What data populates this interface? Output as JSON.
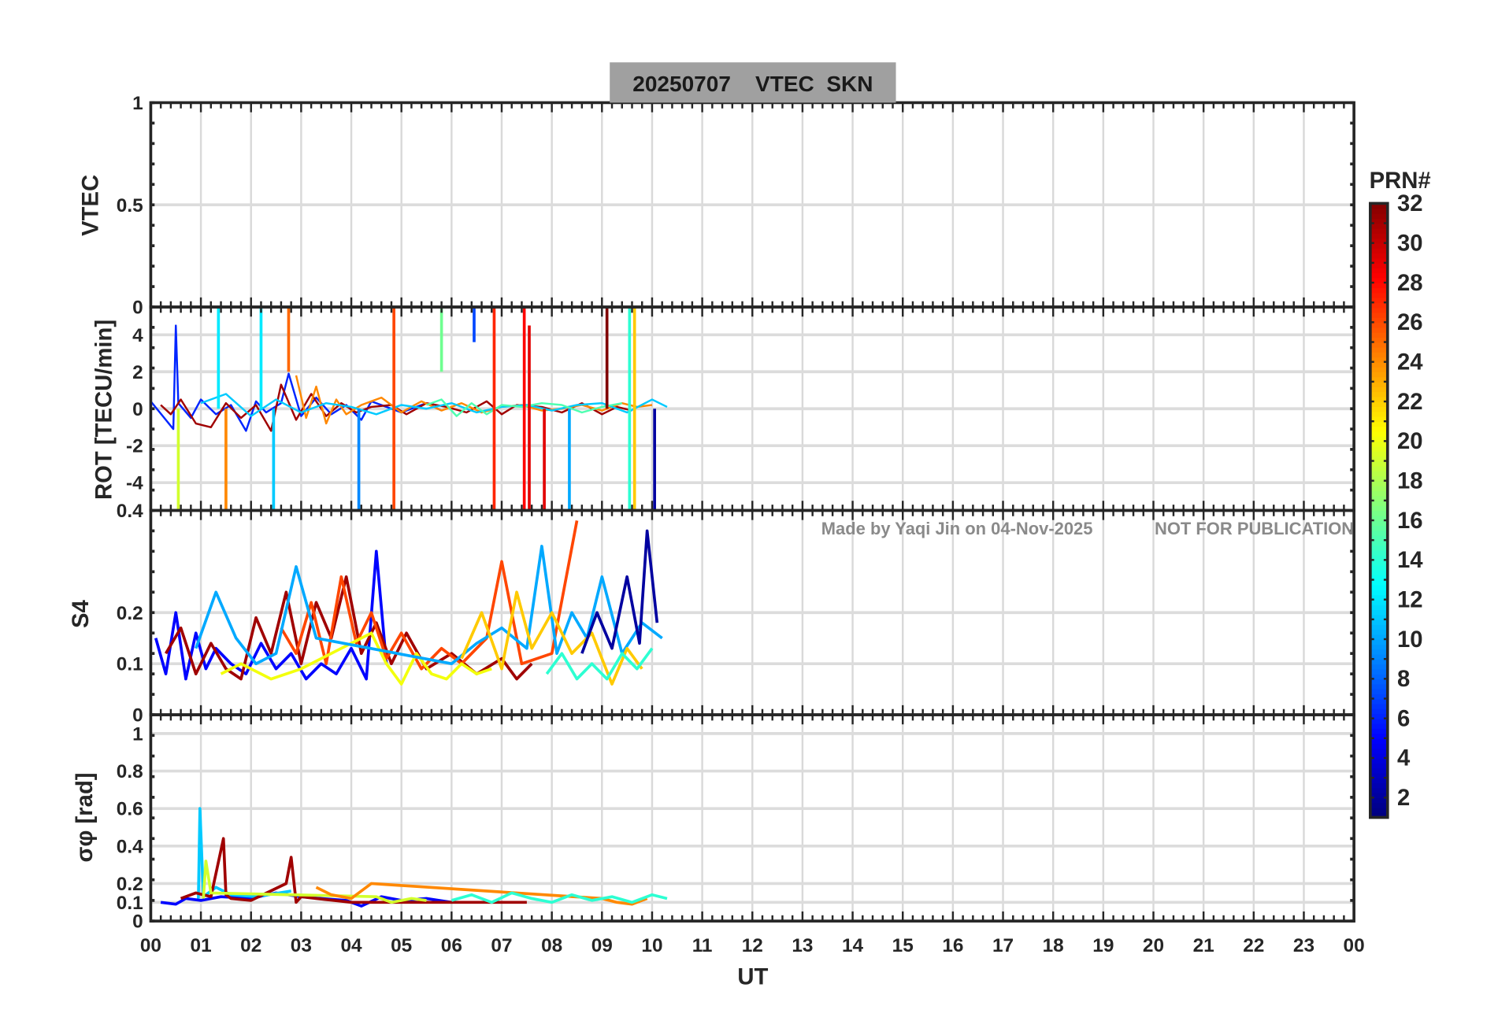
{
  "title": "20250707    VTEC  SKN",
  "watermark": {
    "left": "Made by Yaqi Jin on 04-Nov-2025",
    "right": "NOT FOR PUBLICATION"
  },
  "colorbar": {
    "label": "PRN#",
    "range": [
      1,
      32
    ],
    "ticks": [
      "2",
      "4",
      "6",
      "8",
      "10",
      "12",
      "14",
      "16",
      "18",
      "20",
      "22",
      "24",
      "26",
      "28",
      "30",
      "32"
    ],
    "colormap": "jet"
  },
  "x_axis": {
    "label": "UT",
    "range_hours": [
      0,
      24
    ],
    "ticks": [
      "00",
      "01",
      "02",
      "03",
      "04",
      "05",
      "06",
      "07",
      "08",
      "09",
      "10",
      "11",
      "12",
      "13",
      "14",
      "15",
      "16",
      "17",
      "18",
      "19",
      "20",
      "21",
      "22",
      "23",
      "00"
    ]
  },
  "chart_data": [
    {
      "type": "line",
      "panel": "vtec",
      "ylabel": "VTEC",
      "ylim": [
        0,
        1
      ],
      "yticks": [
        "0",
        "0.5",
        "1"
      ],
      "grid": true,
      "series": []
    },
    {
      "type": "line",
      "panel": "rot",
      "ylabel": "ROT [TECU/min]",
      "ylim": [
        -5.5,
        5.5
      ],
      "yticks": [
        "-4",
        "-2",
        "0",
        "2",
        "4"
      ],
      "grid": true,
      "series": [
        {
          "prn": 6,
          "x": [
            0.0,
            0.3,
            0.45,
            0.5,
            0.55,
            0.8,
            1.0,
            1.3,
            1.6,
            1.9,
            2.1,
            2.3,
            2.6,
            2.75,
            3.0,
            3.3,
            3.6,
            3.9,
            4.2,
            4.4,
            4.7,
            5.0,
            5.5,
            5.8
          ],
          "y": [
            0.4,
            -0.6,
            -1.1,
            4.5,
            0.3,
            -0.5,
            0.5,
            -0.3,
            0.2,
            -1.2,
            0.4,
            -0.2,
            0.3,
            1.9,
            -0.4,
            0.6,
            -0.3,
            0.2,
            -0.6,
            0.4,
            0.1,
            -0.2,
            0.3,
            -0.1
          ]
        },
        {
          "prn": 31,
          "x": [
            0.2,
            0.4,
            0.6,
            0.9,
            1.2,
            1.5,
            1.8,
            2.1,
            2.4,
            2.6,
            2.9,
            3.2,
            3.5,
            3.8,
            4.1,
            4.4,
            4.8,
            5.1,
            5.5,
            5.9,
            6.3,
            6.7,
            7.0,
            7.3,
            7.8,
            8.2,
            8.6,
            9.0,
            9.3,
            9.6
          ],
          "y": [
            0.2,
            -0.3,
            0.5,
            -0.8,
            -1.0,
            0.3,
            -0.5,
            0.2,
            -1.2,
            1.3,
            -0.6,
            0.8,
            -0.4,
            0.3,
            -0.2,
            0.1,
            0.2,
            -0.3,
            0.3,
            0.1,
            -0.2,
            0.4,
            -0.3,
            0.2,
            0.1,
            -0.2,
            0.3,
            -0.3,
            0.1,
            -0.1
          ]
        },
        {
          "prn": 24,
          "x": [
            2.9,
            3.1,
            3.3,
            3.5,
            3.7,
            3.9,
            4.2,
            4.6,
            5.0,
            5.4,
            5.8,
            6.2,
            6.6,
            7.0,
            7.4,
            7.8,
            8.2,
            8.6,
            9.0,
            9.4,
            9.7,
            10.0
          ],
          "y": [
            1.8,
            -0.5,
            1.2,
            -0.8,
            0.5,
            -0.3,
            0.2,
            0.6,
            -0.2,
            0.4,
            -0.1,
            0.3,
            -0.2,
            0.1,
            0.2,
            -0.1,
            0.0,
            0.2,
            -0.1,
            0.3,
            0.1,
            0.2
          ]
        },
        {
          "prn": 11,
          "x": [
            1.0,
            1.5,
            2.0,
            2.5,
            3.0,
            3.5,
            4.0,
            4.5,
            5.0,
            5.5,
            6.0,
            6.5,
            7.0,
            7.5,
            8.0,
            8.5,
            9.0,
            9.5,
            10.0,
            10.3
          ],
          "y": [
            0.3,
            0.8,
            -0.4,
            0.5,
            -0.2,
            0.3,
            0.1,
            -0.3,
            0.2,
            0.0,
            0.3,
            -0.2,
            0.1,
            0.2,
            -0.1,
            0.2,
            0.3,
            -0.2,
            0.5,
            0.1
          ]
        },
        {
          "prn": 15,
          "x": [
            5.5,
            5.8,
            6.1,
            6.4,
            6.7,
            7.0,
            7.4,
            7.8,
            8.2,
            8.6,
            9.0,
            9.4
          ],
          "y": [
            0.2,
            0.5,
            -0.4,
            0.3,
            -0.3,
            0.2,
            0.1,
            0.3,
            0.2,
            -0.2,
            0.1,
            0.3
          ]
        }
      ],
      "spikes": [
        {
          "prn": 19,
          "x": 0.55,
          "from": 0,
          "to": -5.5
        },
        {
          "prn": 12,
          "x": 1.35,
          "from": 0,
          "to": 5.5
        },
        {
          "prn": 24,
          "x": 1.5,
          "from": 0,
          "to": -5.5
        },
        {
          "prn": 12,
          "x": 2.2,
          "from": 0,
          "to": 5.5
        },
        {
          "prn": 11,
          "x": 2.45,
          "from": 0,
          "to": -5.5
        },
        {
          "prn": 25,
          "x": 2.75,
          "from": 2,
          "to": 5.5
        },
        {
          "prn": 9,
          "x": 4.15,
          "from": 0,
          "to": -5.5
        },
        {
          "prn": 26,
          "x": 4.85,
          "from": 5.5,
          "to": -5.5
        },
        {
          "prn": 16,
          "x": 5.8,
          "from": 2,
          "to": 5.5
        },
        {
          "prn": 7,
          "x": 6.45,
          "from": 3.6,
          "to": 5.5
        },
        {
          "prn": 27,
          "x": 6.85,
          "from": 5.5,
          "to": -5.5
        },
        {
          "prn": 28,
          "x": 7.45,
          "from": 5.5,
          "to": -5.5
        },
        {
          "prn": 29,
          "x": 7.55,
          "from": 4.5,
          "to": -5.5
        },
        {
          "prn": 29,
          "x": 7.85,
          "from": 0,
          "to": -5.5
        },
        {
          "prn": 10,
          "x": 8.35,
          "from": 0,
          "to": -5.5
        },
        {
          "prn": 32,
          "x": 9.1,
          "from": 5.5,
          "to": 0
        },
        {
          "prn": 14,
          "x": 9.55,
          "from": 5.5,
          "to": -5.5
        },
        {
          "prn": 22,
          "x": 9.65,
          "from": 5.5,
          "to": -5.5
        },
        {
          "prn": 2,
          "x": 10.05,
          "from": 0,
          "to": -5.5
        }
      ]
    },
    {
      "type": "line",
      "panel": "s4",
      "ylabel": "S4",
      "ylim": [
        0,
        0.4
      ],
      "yticks": [
        "0",
        "0.1",
        "0.2",
        "0.4"
      ],
      "grid": true,
      "series": [
        {
          "prn": 5,
          "x": [
            0.1,
            0.3,
            0.5,
            0.7,
            0.9,
            1.1,
            1.3,
            1.6,
            1.9,
            2.2,
            2.5,
            2.8,
            3.1,
            3.4,
            3.7,
            4.0,
            4.3,
            4.5,
            4.7
          ],
          "y": [
            0.15,
            0.08,
            0.2,
            0.07,
            0.16,
            0.09,
            0.13,
            0.1,
            0.08,
            0.14,
            0.09,
            0.12,
            0.07,
            0.1,
            0.08,
            0.13,
            0.07,
            0.32,
            0.1
          ]
        },
        {
          "prn": 31,
          "x": [
            0.3,
            0.6,
            0.9,
            1.2,
            1.5,
            1.8,
            2.1,
            2.4,
            2.7,
            3.0,
            3.3,
            3.6,
            3.9,
            4.2,
            4.5,
            4.8,
            5.1,
            5.5,
            6.0,
            6.5,
            7.0,
            7.3,
            7.6
          ],
          "y": [
            0.12,
            0.17,
            0.08,
            0.14,
            0.09,
            0.07,
            0.19,
            0.12,
            0.24,
            0.1,
            0.22,
            0.15,
            0.27,
            0.12,
            0.18,
            0.1,
            0.16,
            0.09,
            0.12,
            0.08,
            0.11,
            0.07,
            0.1
          ]
        },
        {
          "prn": 26,
          "x": [
            2.6,
            2.9,
            3.2,
            3.5,
            3.8,
            4.1,
            4.4,
            4.7,
            5.0,
            5.4,
            5.8,
            6.2,
            6.7,
            7.0,
            7.4,
            8.0,
            8.5
          ],
          "y": [
            0.17,
            0.12,
            0.22,
            0.1,
            0.27,
            0.14,
            0.2,
            0.11,
            0.16,
            0.09,
            0.13,
            0.1,
            0.15,
            0.3,
            0.1,
            0.12,
            0.38
          ]
        },
        {
          "prn": 20,
          "x": [
            1.4,
            1.8,
            2.4,
            3.0,
            4.4,
            4.7,
            5.0,
            5.3,
            5.6,
            5.9,
            6.2,
            6.5,
            6.8
          ],
          "y": [
            0.08,
            0.1,
            0.07,
            0.09,
            0.16,
            0.1,
            0.06,
            0.12,
            0.08,
            0.07,
            0.1,
            0.08,
            0.09
          ]
        },
        {
          "prn": 10,
          "x": [
            0.9,
            1.3,
            1.7,
            2.1,
            2.5,
            2.9,
            3.3,
            6.0,
            6.5,
            7.0,
            7.5,
            7.8,
            8.1,
            8.4,
            8.7,
            9.0,
            9.4,
            9.8,
            10.2
          ],
          "y": [
            0.13,
            0.24,
            0.15,
            0.1,
            0.12,
            0.29,
            0.15,
            0.1,
            0.14,
            0.17,
            0.13,
            0.33,
            0.12,
            0.2,
            0.15,
            0.27,
            0.12,
            0.18,
            0.15
          ]
        },
        {
          "prn": 22,
          "x": [
            6.2,
            6.6,
            7.0,
            7.3,
            7.6,
            8.0,
            8.4,
            8.8,
            9.2,
            9.5,
            9.8
          ],
          "y": [
            0.11,
            0.2,
            0.09,
            0.24,
            0.13,
            0.2,
            0.12,
            0.16,
            0.06,
            0.13,
            0.09
          ]
        },
        {
          "prn": 14,
          "x": [
            7.9,
            8.2,
            8.5,
            8.8,
            9.1,
            9.4,
            9.7,
            10.0
          ],
          "y": [
            0.08,
            0.12,
            0.07,
            0.1,
            0.07,
            0.12,
            0.09,
            0.13
          ]
        },
        {
          "prn": 2,
          "x": [
            8.6,
            8.9,
            9.2,
            9.5,
            9.75,
            9.9,
            10.1
          ],
          "y": [
            0.12,
            0.2,
            0.13,
            0.27,
            0.14,
            0.36,
            0.18
          ]
        }
      ]
    },
    {
      "type": "line",
      "panel": "sigma_phi",
      "ylabel": "σφ [rad]",
      "ylim": [
        0,
        1.1
      ],
      "yticks": [
        "0",
        "0.1",
        "0.2",
        "0.4",
        "0.6",
        "0.8",
        "1"
      ],
      "grid": true,
      "series": [
        {
          "prn": 5,
          "x": [
            0.2,
            0.5,
            0.7,
            1.0,
            1.4,
            2.0,
            2.5,
            3.0,
            3.4,
            3.9,
            4.2,
            4.6,
            5.0,
            5.5,
            6.0
          ],
          "y": [
            0.1,
            0.09,
            0.12,
            0.11,
            0.13,
            0.12,
            0.15,
            0.13,
            0.12,
            0.11,
            0.08,
            0.13,
            0.11,
            0.12,
            0.1
          ]
        },
        {
          "prn": 11,
          "x": [
            0.95,
            0.98,
            1.05,
            1.3,
            1.6,
            2.1,
            2.8
          ],
          "y": [
            0.12,
            0.6,
            0.13,
            0.18,
            0.14,
            0.13,
            0.16
          ]
        },
        {
          "prn": 31,
          "x": [
            0.6,
            0.9,
            1.2,
            1.45,
            1.5,
            1.6,
            2.0,
            2.7,
            2.8,
            2.9,
            3.0,
            3.3,
            4.0,
            7.5
          ],
          "y": [
            0.12,
            0.15,
            0.13,
            0.44,
            0.14,
            0.12,
            0.11,
            0.2,
            0.34,
            0.1,
            0.13,
            0.12,
            0.1,
            0.1
          ]
        },
        {
          "prn": 19,
          "x": [
            1.05,
            1.1,
            1.2,
            4.5,
            4.8,
            5.2,
            5.5
          ],
          "y": [
            0.12,
            0.32,
            0.15,
            0.13,
            0.1,
            0.12,
            0.11
          ]
        },
        {
          "prn": 24,
          "x": [
            3.3,
            3.6,
            4.0,
            4.4,
            9.0,
            9.3,
            9.6,
            9.9
          ],
          "y": [
            0.18,
            0.14,
            0.12,
            0.2,
            0.12,
            0.1,
            0.09,
            0.12
          ]
        },
        {
          "prn": 14,
          "x": [
            6.0,
            6.4,
            6.8,
            7.2,
            7.6,
            8.0,
            8.4,
            8.8,
            9.2,
            9.6,
            10.0,
            10.3
          ],
          "y": [
            0.11,
            0.14,
            0.1,
            0.15,
            0.12,
            0.1,
            0.14,
            0.11,
            0.13,
            0.1,
            0.14,
            0.12
          ]
        }
      ]
    }
  ]
}
